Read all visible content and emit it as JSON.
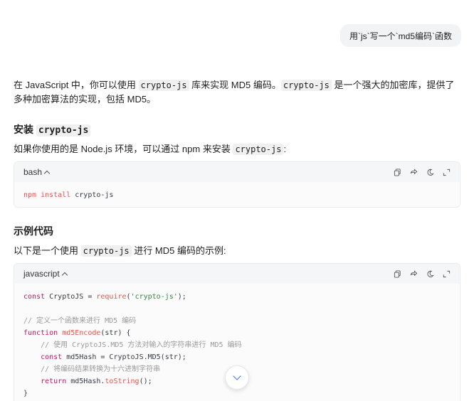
{
  "user_message": "用`js`写一个`md5编码`函数",
  "intro": {
    "t1": "在 JavaScript 中，你可以使用 ",
    "c1": "crypto-js",
    "t2": " 库来实现 MD5 编码。",
    "c2": "crypto-js",
    "t3": " 是一个强大的加密库，提供了多种加密算法的实现，包括 MD5。"
  },
  "section_install": {
    "heading_prefix": "安装 ",
    "heading_code": "crypto-js",
    "desc_prefix": "如果你使用的是 Node.js 环境，可以通过 npm 来安装 ",
    "desc_code": "crypto-js",
    "desc_suffix": ":"
  },
  "code_install": {
    "lang": "bash",
    "line1_cmd": "npm install",
    "line1_arg": " crypto-js"
  },
  "section_example": {
    "heading": "示例代码",
    "desc_prefix": "以下是一个使用 ",
    "desc_code": "crypto-js",
    "desc_suffix": " 进行 MD5 编码的示例:"
  },
  "code_example": {
    "lang": "javascript",
    "l1_kw": "const",
    "l1_a": " CryptoJS = ",
    "l1_fn": "require",
    "l1_b": "(",
    "l1_str": "'crypto-js'",
    "l1_c": ");",
    "l3_comment": "// 定义一个函数来进行 MD5 编码",
    "l4_kw": "function",
    "l4_fn": " md5Encode",
    "l4_rest": "(str) {",
    "l5_comment": "    // 使用 CryptoJS.MD5 方法对输入的字符串进行 MD5 编码",
    "l6_indent": "    ",
    "l6_kw": "const",
    "l6_rest": " md5Hash = CryptoJS.MD5(str);",
    "l7_comment": "    // 将编码结果转换为十六进制字符串",
    "l8_indent": "    ",
    "l8_kw": "return",
    "l8_a": " md5Hash.",
    "l8_fn": "toString",
    "l8_b": "();",
    "l9": "}"
  },
  "icons": [
    "copy-icon",
    "share-icon",
    "theme-icon",
    "expand-icon",
    "chevron-up-icon",
    "scroll-down-icon"
  ]
}
